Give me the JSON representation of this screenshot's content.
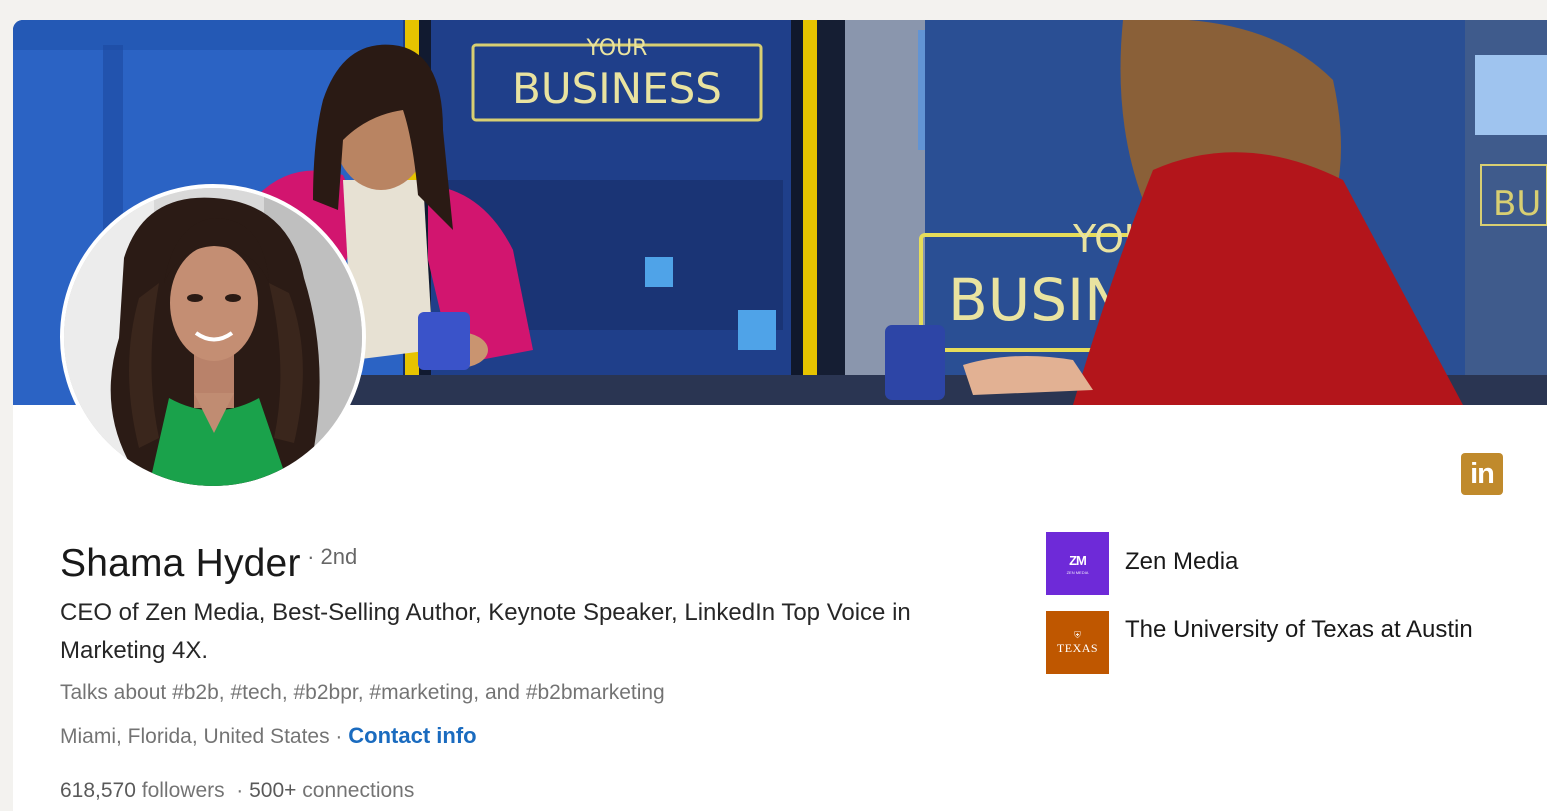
{
  "banner": {
    "sign_small_text": "YOUR",
    "sign_large_text": "BUSINESS",
    "sign2_small_text": "YOU",
    "sign2_large_text": "BUSIN",
    "sign3_text": "BU"
  },
  "profile": {
    "name": "Shama Hyder",
    "degree": "· 2nd",
    "headline": "CEO of Zen Media, Best-Selling Author, Keynote Speaker, LinkedIn Top Voice in Marketing 4X.",
    "talks_about": "Talks about #b2b, #tech, #b2bpr, #marketing, and #b2bmarketing",
    "location": "Miami, Florida, United States · ",
    "contact_info": "Contact info",
    "followers": "618,570",
    "followers_label": " followers",
    "connections_sep": "  · ",
    "connections": "500+",
    "connections_label": " connections"
  },
  "linkedin_badge": "in",
  "organizations": [
    {
      "name": "Zen Media",
      "logo_mark": "ZM",
      "logo_sub": "ZEN MEDIA"
    },
    {
      "name": "The University of Texas at Austin",
      "logo_mark": "TEXAS"
    }
  ],
  "colors": {
    "link": "#1a6bbf",
    "linkedin_badge": "#c08a2c",
    "zen_media": "#6e2ad8",
    "texas": "#bf5700"
  }
}
